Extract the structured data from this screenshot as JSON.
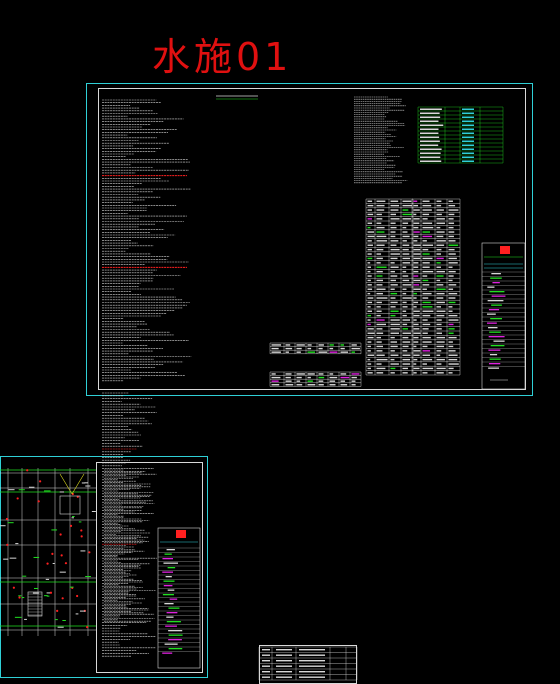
{
  "drawing": {
    "title": "水施01",
    "colors": {
      "background": "#000000",
      "title": "#e01010",
      "frame": "#2fd0d6",
      "linework": "#d8d8d8",
      "accent_red": "#ff2020",
      "accent_green": "#20e020",
      "accent_magenta": "#e020e0",
      "accent_yellow": "#e0e020"
    },
    "icons": [
      "drawing-sheet",
      "floor-plan",
      "title-block"
    ]
  }
}
